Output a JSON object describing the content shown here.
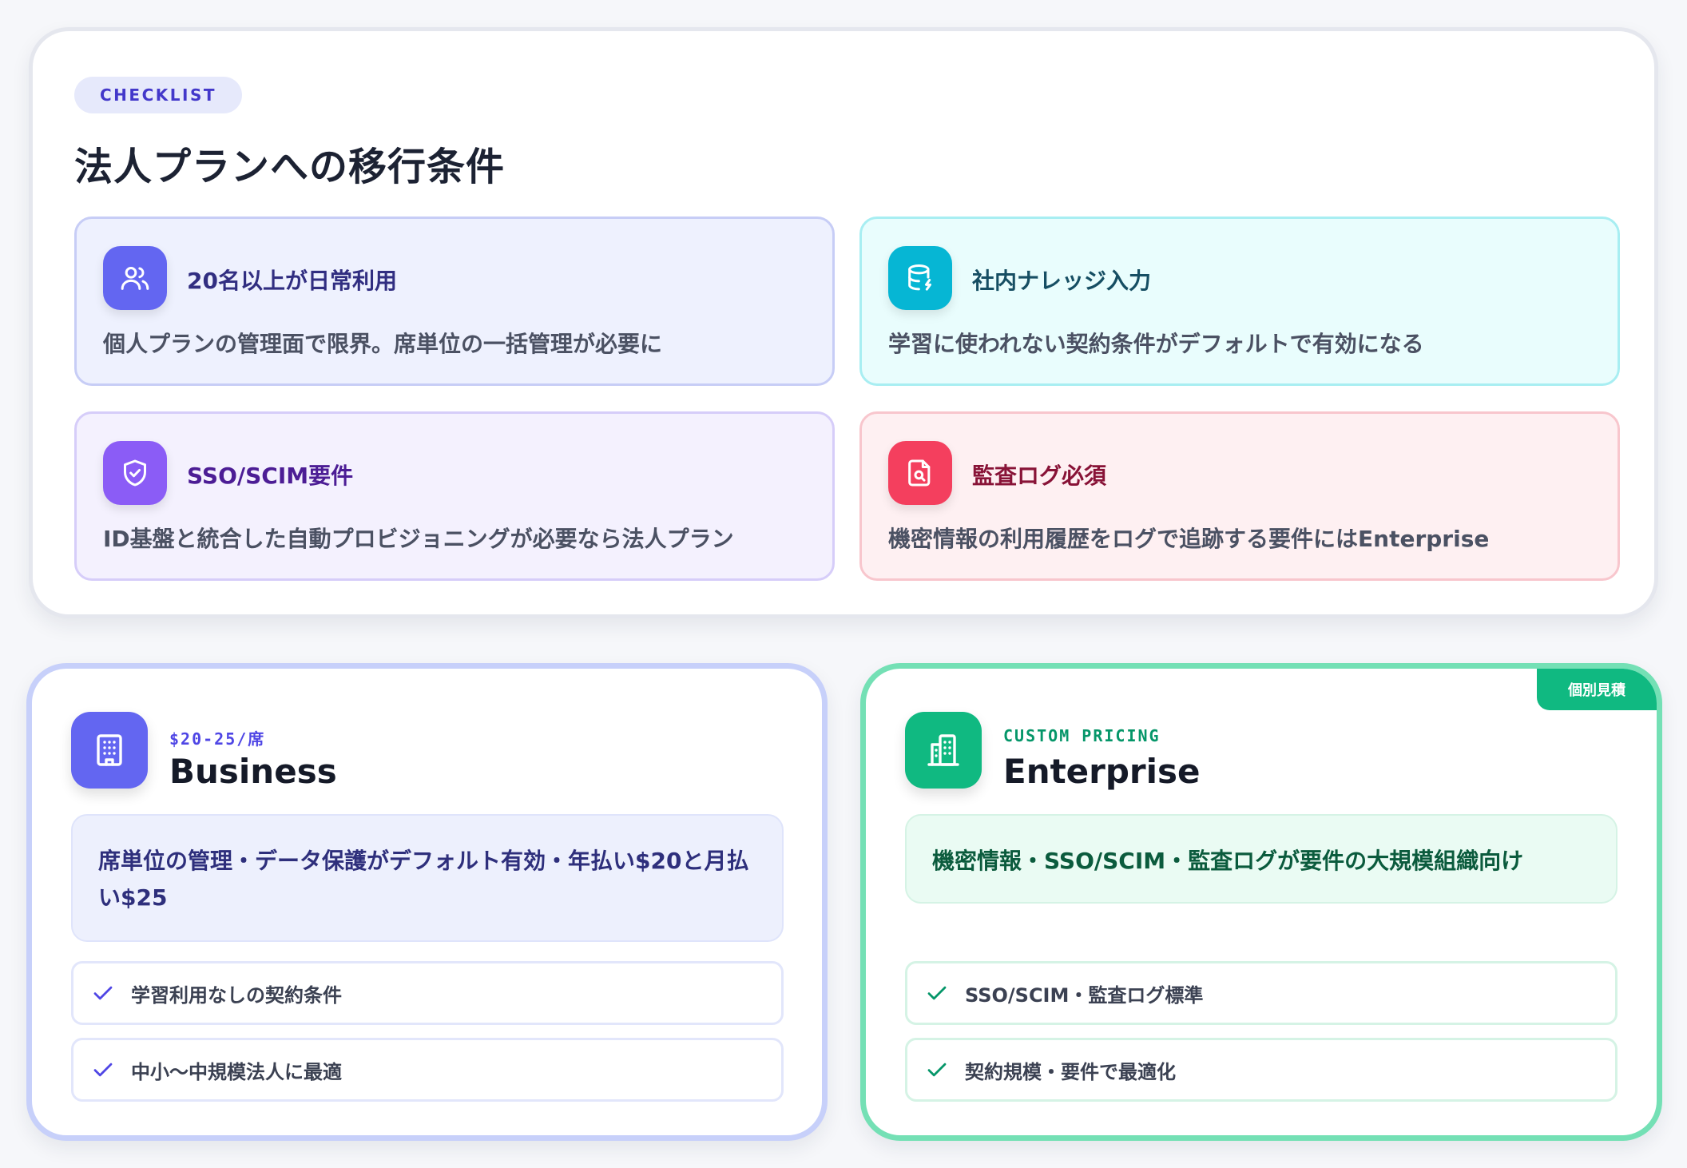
{
  "checklist": {
    "pill": "CHECKLIST",
    "title": "法人プランへの移行条件",
    "items": [
      {
        "icon": "users-icon",
        "title": "20名以上が日常利用",
        "desc": "個人プランの管理面で限界。席単位の一括管理が必要に"
      },
      {
        "icon": "database-icon",
        "title": "社内ナレッジ入力",
        "desc": "学習に使われない契約条件がデフォルトで有効になる"
      },
      {
        "icon": "shield-check-icon",
        "title": "SSO/SCIM要件",
        "desc": "ID基盤と統合した自動プロビジョニングが必要なら法人プラン"
      },
      {
        "icon": "file-search-icon",
        "title": "監査ログ必須",
        "desc": "機密情報の利用履歴をログで追跡する要件にはEnterprise"
      }
    ]
  },
  "plans": {
    "business": {
      "icon": "building-icon",
      "kicker": "$20-25/席",
      "name": "Business",
      "summary": "席単位の管理・データ保護がデフォルト有効・年払い$20と月払い$25",
      "features": [
        "学習利用なしの契約条件",
        "中小〜中規模法人に最適"
      ]
    },
    "enterprise": {
      "icon": "buildings-icon",
      "badge": "個別見積",
      "kicker": "CUSTOM PRICING",
      "name": "Enterprise",
      "summary": "機密情報・SSO/SCIM・監査ログが要件の大規模組織向け",
      "features": [
        "SSO/SCIM・監査ログ標準",
        "契約規模・要件で最適化"
      ]
    }
  },
  "colors": {
    "indigo": "#6366f1",
    "cyan": "#06b6d4",
    "violet": "#8b5cf6",
    "rose": "#f43f5e",
    "emerald": "#10b981"
  }
}
